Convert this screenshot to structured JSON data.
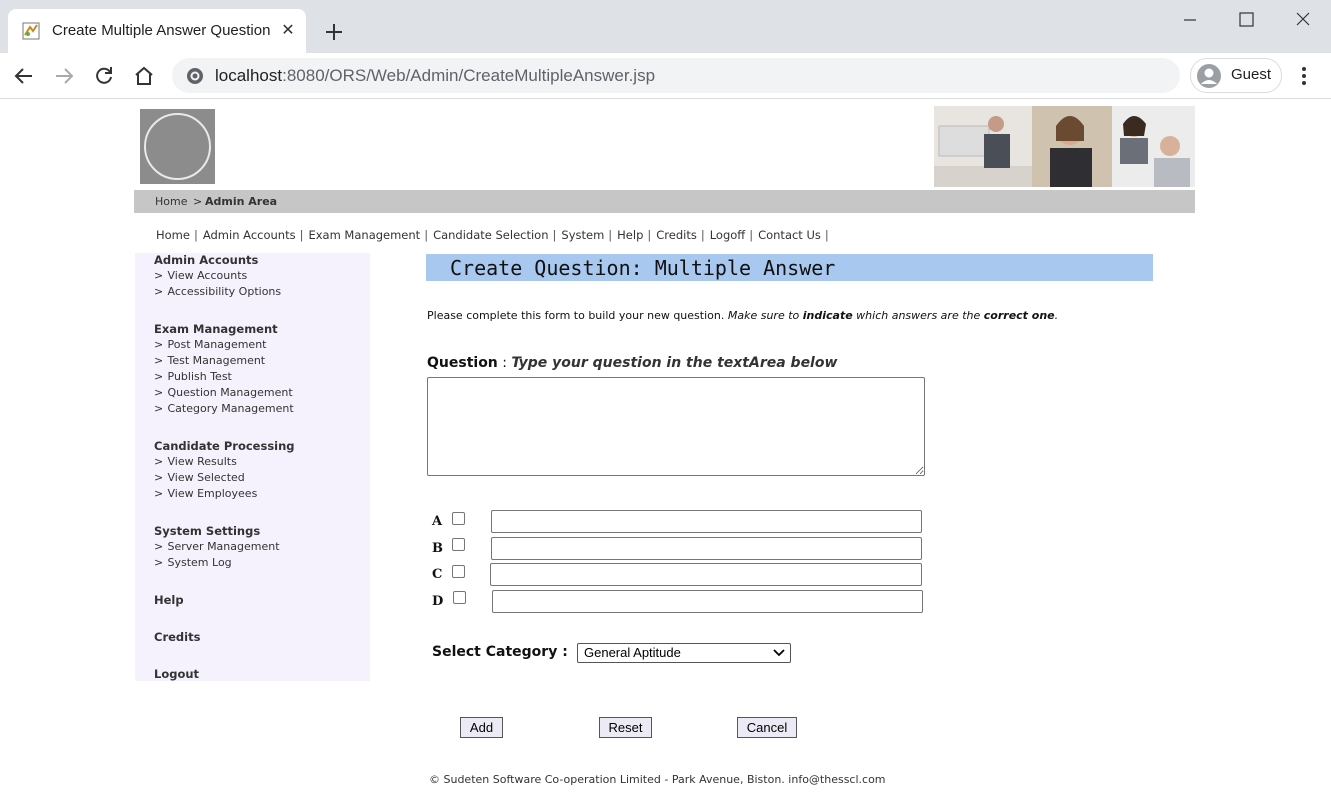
{
  "browser": {
    "tab_title": "Create Multiple Answer Question",
    "url_host": "localhost",
    "url_rest": ":8080/ORS/Web/Admin/CreateMultipleAnswer.jsp",
    "profile_name": "Guest",
    "icons": [
      "back-icon",
      "forward-icon",
      "reload-icon",
      "home-icon",
      "info-icon",
      "close-icon",
      "new-tab-icon",
      "minimize-icon",
      "maximize-icon",
      "window-close-icon",
      "avatar-icon",
      "menu-icon"
    ]
  },
  "breadcrumb": {
    "home": "Home",
    "sep": ">",
    "current": "Admin Area"
  },
  "topnav": {
    "items": [
      "Home",
      "Admin Accounts",
      "Exam Management",
      "Candidate Selection",
      "System",
      "Help",
      "Credits",
      "Logoff",
      "Contact Us"
    ]
  },
  "sidebar": {
    "admin_accounts": {
      "heading": "Admin Accounts",
      "items": [
        "View Accounts",
        "Accessibility Options"
      ]
    },
    "exam_management": {
      "heading": "Exam Management",
      "items": [
        "Post Management",
        "Test Management",
        "Publish Test",
        "Question Management",
        "Category Management"
      ]
    },
    "candidate_processing": {
      "heading": "Candidate Processing",
      "items": [
        "View Results",
        "View Selected",
        "View Employees"
      ]
    },
    "system_settings": {
      "heading": "System Settings",
      "items": [
        "Server Management",
        "System Log"
      ]
    },
    "help": "Help",
    "credits": "Credits",
    "logout": "Logout"
  },
  "form": {
    "title": "Create Question: Multiple Answer",
    "instructions": {
      "plain": "Please complete this form to build your new question. ",
      "italic1": "Make sure to ",
      "bold1": "indicate",
      "italic2": " which answers are the ",
      "bold2": "correct one",
      "end": "."
    },
    "question_label": "Question",
    "question_sep": " : ",
    "question_hint": "Type your question in the textArea below",
    "question_value": "",
    "options": [
      {
        "letter": "A",
        "checked": false,
        "value": ""
      },
      {
        "letter": "B",
        "checked": false,
        "value": ""
      },
      {
        "letter": "C",
        "checked": false,
        "value": ""
      },
      {
        "letter": "D",
        "checked": false,
        "value": ""
      }
    ],
    "category_label": "Select Category :",
    "category_selected": "General Aptitude",
    "buttons": {
      "add": "Add",
      "reset": "Reset",
      "cancel": "Cancel"
    }
  },
  "footer": "© Sudeten Software Co-operation Limited - Park Avenue, Biston. info@thesscl.com"
}
